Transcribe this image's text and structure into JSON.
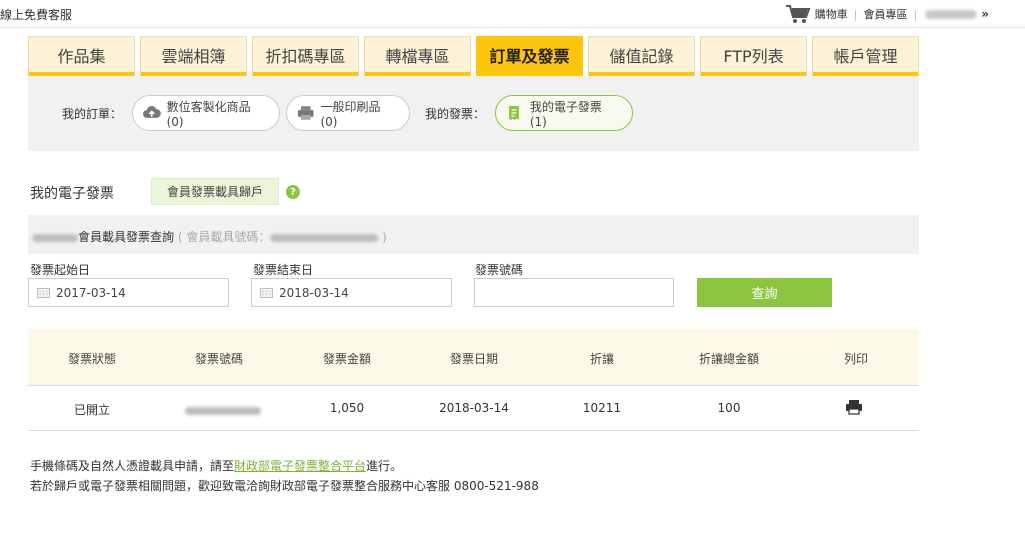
{
  "topbar": {
    "service_label": "線上免費客服",
    "cart_label": "購物車",
    "member_label": "會員專區"
  },
  "tabs": [
    {
      "label": "作品集",
      "active": false
    },
    {
      "label": "雲端相簿",
      "active": false
    },
    {
      "label": "折扣碼專區",
      "active": false
    },
    {
      "label": "轉檔專區",
      "active": false
    },
    {
      "label": "訂單及發票",
      "active": true
    },
    {
      "label": "儲值記錄",
      "active": false
    },
    {
      "label": "FTP列表",
      "active": false
    },
    {
      "label": "帳戶管理",
      "active": false
    }
  ],
  "orders": {
    "label": "我的訂單：",
    "digital": "數位客製化商品 (0)",
    "print": "一般印刷品 (0)"
  },
  "invoices": {
    "label": "我的發票：",
    "einvoice": "我的電子發票 (1)"
  },
  "section": {
    "title": "我的電子發票",
    "carrier_button": "會員發票載具歸戶",
    "help_symbol": "?"
  },
  "query": {
    "title": "會員載具發票查詢",
    "carrier_prefix": "( 會員載具號碼：",
    "carrier_suffix": ")"
  },
  "filters": {
    "start_label": "發票起始日",
    "start_value": "2017-03-14",
    "end_label": "發票結束日",
    "end_value": "2018-03-14",
    "number_label": "發票號碼",
    "number_value": "",
    "submit": "查詢"
  },
  "table": {
    "headers": [
      "發票狀態",
      "發票號碼",
      "發票金額",
      "發票日期",
      "折讓",
      "折讓總金額",
      "列印"
    ],
    "rows": [
      {
        "status": "已開立",
        "amount": "1,050",
        "date": "2018-03-14",
        "allowance": "10211",
        "allowance_total": "100"
      }
    ]
  },
  "notes": {
    "line1_before": "手機條碼及自然人憑證載具申請，請至",
    "line1_link": "財政部電子發票整合平台",
    "line1_after": "進行。",
    "line2": "若於歸戶或電子發票相關問題，歡迎致電洽詢財政部電子發票整合服務中心客服 0800-521-988"
  },
  "colors": {
    "accent_yellow": "#ffc40c",
    "accent_green": "#8cc63f",
    "panel_gray": "#f1f1f1"
  },
  "icons": {
    "cart": "cart-icon",
    "cloud": "cloud-upload-icon",
    "printer": "printer-icon",
    "invoice": "receipt-icon",
    "calendar": "calendar-icon",
    "help": "question-icon"
  }
}
